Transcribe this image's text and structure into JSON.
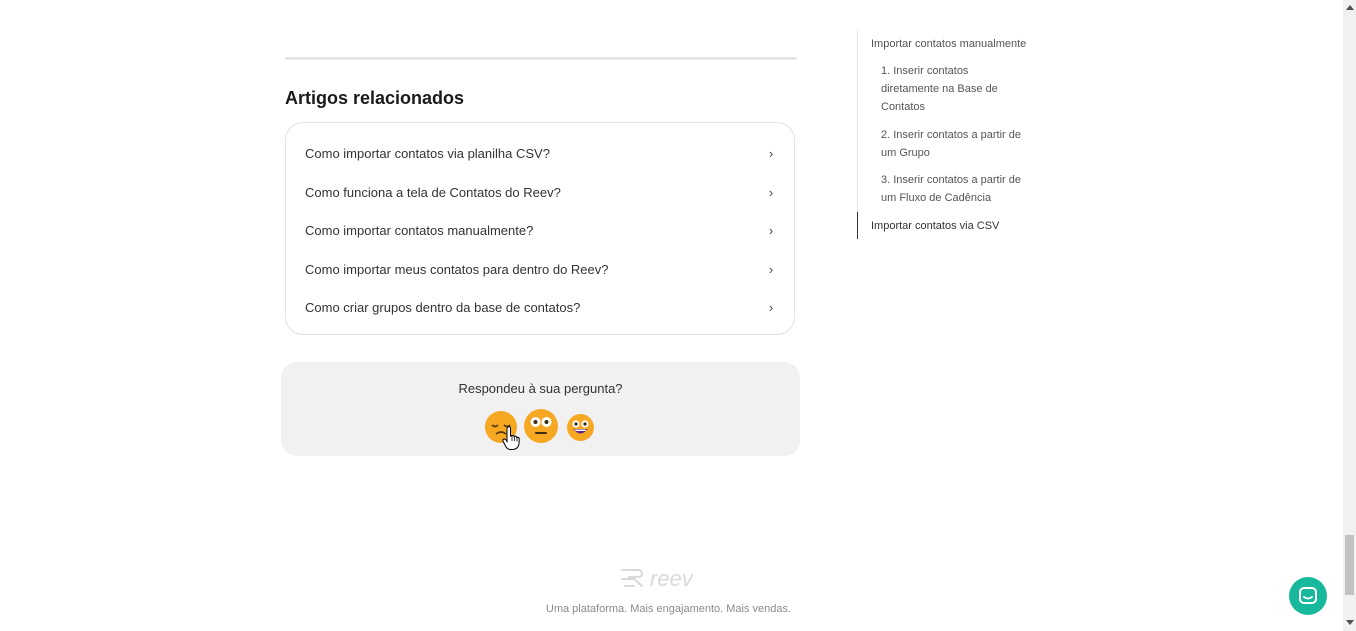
{
  "related": {
    "title": "Artigos relacionados",
    "items": [
      {
        "label": "Como importar contatos via planilha CSV?"
      },
      {
        "label": "Como funciona a tela de Contatos do Reev?"
      },
      {
        "label": "Como importar contatos manualmente?"
      },
      {
        "label": "Como importar meus contatos para dentro do Reev?"
      },
      {
        "label": "Como criar grupos dentro da base de contatos?"
      }
    ],
    "chevron": "›"
  },
  "feedback": {
    "question": "Respondeu à sua pergunta?",
    "options": [
      "disappointed-emoji",
      "neutral-emoji",
      "smiley-emoji"
    ]
  },
  "toc": {
    "items": [
      {
        "label": "Importar contatos manualmente",
        "level": 1
      },
      {
        "label": "1. Inserir contatos diretamente na Base de Contatos",
        "level": 2
      },
      {
        "label": "2. Inserir contatos a partir de um Grupo",
        "level": 2
      },
      {
        "label": "3. Inserir contatos a partir de um Fluxo de Cadência",
        "level": 2
      },
      {
        "label": "Importar contatos via CSV",
        "level": 1
      }
    ]
  },
  "footer": {
    "logo_text": "reev",
    "tagline": "Uma plataforma. Mais engajamento. Mais vendas."
  },
  "colors": {
    "accent": "#17b89c",
    "emoji": "#f6a823"
  }
}
